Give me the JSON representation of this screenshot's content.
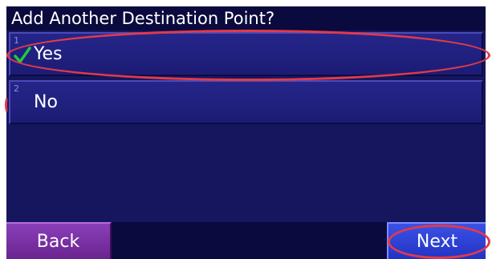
{
  "header": {
    "title": "Add Another Destination Point?"
  },
  "options": [
    {
      "number": "1",
      "label": "Yes",
      "selected": true
    },
    {
      "number": "2",
      "label": "No",
      "selected": false
    }
  ],
  "footer": {
    "back_label": "Back",
    "next_label": "Next"
  },
  "colors": {
    "screen_background": "#16165e",
    "option_background": "#25258a",
    "back_button": "#8a3fb8",
    "next_button": "#3b52e6",
    "checkmark": "#22c840",
    "annotation": "#e23a4a"
  },
  "icons": {
    "selected_marker": "checkmark-icon"
  }
}
